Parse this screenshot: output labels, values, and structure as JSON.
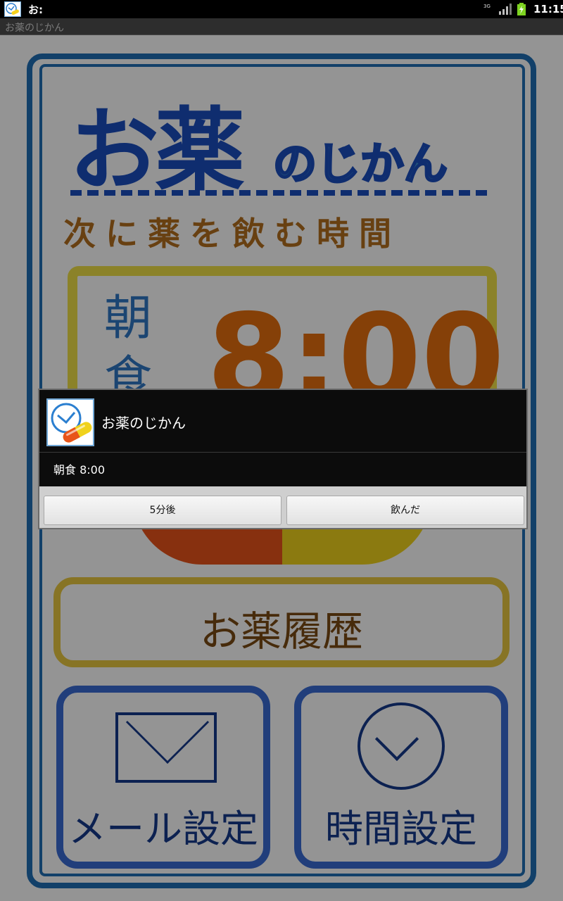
{
  "status_bar": {
    "app_name": "お:",
    "network": "3G",
    "time": "11:15",
    "icons": [
      "app-icon",
      "network-3g-icon",
      "signal-icon",
      "battery-charging-icon"
    ]
  },
  "title_bar": {
    "title": "お薬のじかん"
  },
  "app": {
    "logo": {
      "main": "お薬",
      "sub": "のじかん"
    },
    "subtitle": "次に薬を飲む時間",
    "next_dose": {
      "meal": "朝食",
      "time": "8:00"
    },
    "history_button": "お薬履歴",
    "mail_settings_button": "メール設定",
    "time_settings_button": "時間設定"
  },
  "dialog": {
    "title": "お薬のじかん",
    "message": "朝食 8:00",
    "buttons": {
      "snooze": "5分後",
      "taken": "飲んだ"
    }
  },
  "colors": {
    "brand_blue": "#1f6fb6",
    "accent_orange": "#e56f0f",
    "dialog_bg": "#0c0c0c"
  }
}
